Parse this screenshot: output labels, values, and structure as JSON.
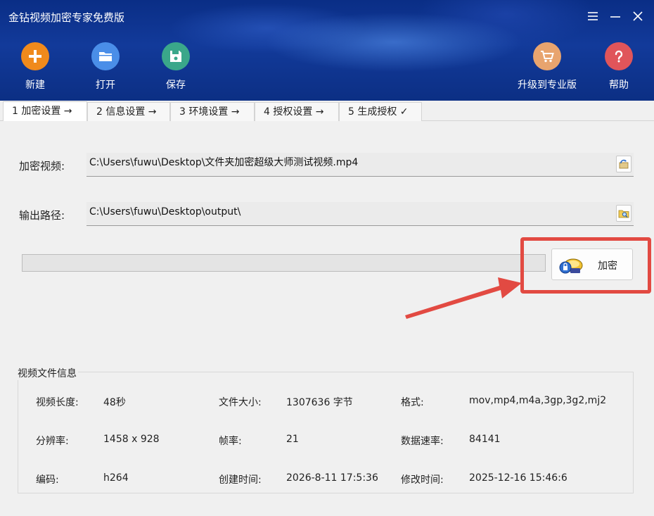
{
  "window": {
    "title": "金钻视频加密专家免费版",
    "controls": [
      "menu-icon",
      "minimize-icon",
      "close-icon"
    ]
  },
  "toolbar": {
    "new": {
      "label": "新建",
      "icon": "plus-icon",
      "color": "#f08a1c"
    },
    "open": {
      "label": "打开",
      "icon": "folder-icon",
      "color": "#4a8ee8"
    },
    "save": {
      "label": "保存",
      "icon": "floppy-disk-icon",
      "color": "#3aa78a"
    },
    "upgrade": {
      "label": "升级到专业版",
      "icon": "cart-icon",
      "color": "#e8a46e"
    },
    "help": {
      "label": "帮助",
      "icon": "question-icon",
      "color": "#e0555a"
    }
  },
  "tabs": [
    {
      "label": "1 加密设置 →",
      "active": true
    },
    {
      "label": "2 信息设置 →",
      "active": false
    },
    {
      "label": "3 环境设置 →",
      "active": false
    },
    {
      "label": "4 授权设置 →",
      "active": false
    },
    {
      "label": "5 生成授权 ✓",
      "active": false
    }
  ],
  "form": {
    "video_label": "加密视频:",
    "video_path": "C:\\Users\\fuwu\\Desktop\\文件夹加密超级大师测试视频.mp4",
    "output_label": "输出路径:",
    "output_path": "C:\\Users\\fuwu\\Desktop\\output\\"
  },
  "progress": {
    "value": 0
  },
  "encrypt_button": {
    "label": "加密",
    "icon": "encrypt-lock-icon"
  },
  "annotation": {
    "color": "#e24a42"
  },
  "info": {
    "title": "视频文件信息",
    "rows": [
      [
        {
          "label": "视频长度:",
          "value": "48秒"
        },
        {
          "label": "文件大小:",
          "value": "1307636 字节"
        },
        {
          "label": "格式:",
          "value": "mov,mp4,m4a,3gp,3g2,mj2"
        }
      ],
      [
        {
          "label": "分辨率:",
          "value": "1458 x 928"
        },
        {
          "label": "帧率:",
          "value": "21"
        },
        {
          "label": "数据速率:",
          "value": "84141"
        }
      ],
      [
        {
          "label": "编码:",
          "value": "h264"
        },
        {
          "label": "创建时间:",
          "value": "2026-8-11 17:5:36"
        },
        {
          "label": "修改时间:",
          "value": "2025-12-16 15:46:6"
        }
      ]
    ]
  }
}
